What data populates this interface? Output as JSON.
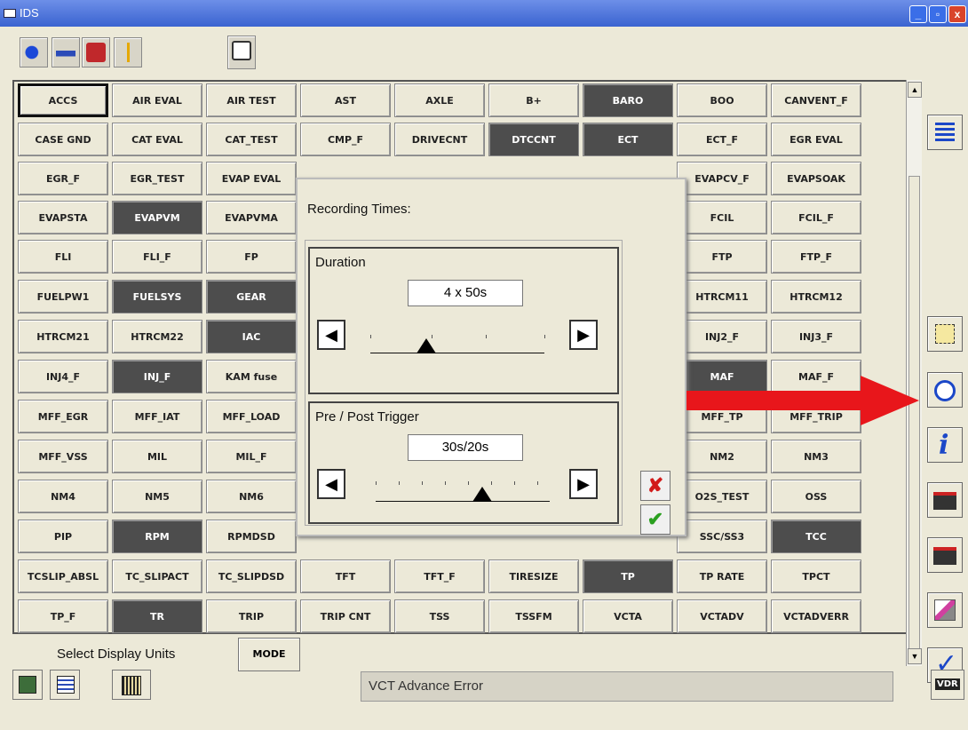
{
  "window": {
    "title": "IDS",
    "min": "_",
    "restore": "▫",
    "close": "x"
  },
  "toolbar": {
    "icons": [
      "back-arrow-icon",
      "vehicle-icon",
      "toolbox-icon",
      "signpost-icon",
      "vdr-monitor-icon"
    ]
  },
  "grid": {
    "rows": [
      [
        "ACCS",
        "AIR EVAL",
        "AIR TEST",
        "AST",
        "AXLE",
        "B+",
        "BARO",
        "BOO",
        "CANVENT_F"
      ],
      [
        "CASE GND",
        "CAT EVAL",
        "CAT_TEST",
        "CMP_F",
        "DRIVECNT",
        "DTCCNT",
        "ECT",
        "ECT_F",
        "EGR EVAL"
      ],
      [
        "EGR_F",
        "EGR_TEST",
        "EVAP EVAL",
        "",
        "",
        "",
        "",
        "EVAPCV_F",
        "EVAPSOAK"
      ],
      [
        "EVAPSTA",
        "EVAPVM",
        "EVAPVMA",
        "",
        "",
        "",
        "",
        "FCIL",
        "FCIL_F"
      ],
      [
        "FLI",
        "FLI_F",
        "FP",
        "",
        "",
        "",
        "",
        "FTP",
        "FTP_F"
      ],
      [
        "FUELPW1",
        "FUELSYS",
        "GEAR",
        "",
        "",
        "",
        "",
        "HTRCM11",
        "HTRCM12"
      ],
      [
        "HTRCM21",
        "HTRCM22",
        "IAC",
        "",
        "",
        "",
        "",
        "INJ2_F",
        "INJ3_F"
      ],
      [
        "INJ4_F",
        "INJ_F",
        "KAM fuse",
        "",
        "",
        "",
        "",
        "MAF",
        "MAF_F"
      ],
      [
        "MFF_EGR",
        "MFF_IAT",
        "MFF_LOAD",
        "",
        "",
        "",
        "",
        "MFF_TP",
        "MFF_TRIP"
      ],
      [
        "MFF_VSS",
        "MIL",
        "MIL_F",
        "",
        "",
        "",
        "",
        "NM2",
        "NM3"
      ],
      [
        "NM4",
        "NM5",
        "NM6",
        "",
        "",
        "",
        "",
        "O2S_TEST",
        "OSS"
      ],
      [
        "PIP",
        "RPM",
        "RPMDSD",
        "",
        "",
        "",
        "",
        "SSC/SS3",
        "TCC"
      ],
      [
        "TCSLIP_ABSL",
        "TC_SLIPACT",
        "TC_SLIPDSD",
        "TFT",
        "TFT_F",
        "TIRESIZE",
        "TP",
        "TP RATE",
        "TPCT"
      ],
      [
        "TP_F",
        "TR",
        "TRIP",
        "TRIP CNT",
        "TSS",
        "TSSFM",
        "VCTA",
        "VCTADV",
        "VCTADVERR"
      ]
    ],
    "selected": [
      "BARO",
      "DTCCNT",
      "ECT",
      "EVAPVM",
      "FUELSYS",
      "GEAR",
      "IAC",
      "INJ_F",
      "MAF",
      "RPM",
      "TCC",
      "TP",
      "TR"
    ],
    "focused": "ACCS"
  },
  "dialog": {
    "title": "Recording Times:",
    "duration": {
      "label": "Duration",
      "value": "4 x 50s",
      "slider_fraction": 0.43
    },
    "trigger": {
      "label": "Pre / Post Trigger",
      "value": "30s/20s",
      "slider_fraction": 0.6
    },
    "left_arrow": "◀",
    "right_arrow": "▶",
    "cancel": "✘",
    "ok": "✔"
  },
  "bottom": {
    "label": "Select Display Units",
    "mode": "MODE"
  },
  "status": {
    "text": "VCT Advance Error"
  },
  "sidebar": {
    "icons": [
      "list-icon",
      "select-pid-icon",
      "stopwatch-icon",
      "info-icon",
      "folder-in-icon",
      "folder-out-icon",
      "edit-icon",
      "check-icon"
    ]
  },
  "footer": {
    "vdr": "VDR"
  }
}
